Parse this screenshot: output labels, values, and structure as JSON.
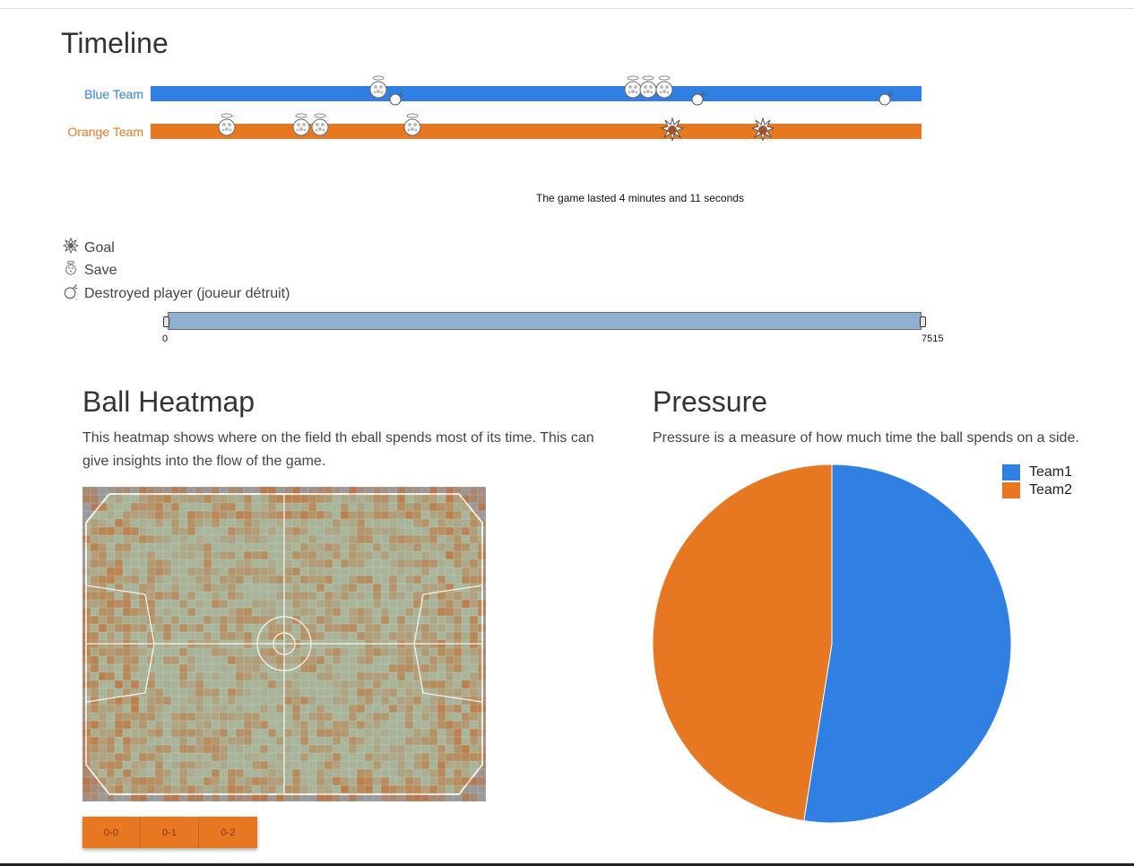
{
  "timeline": {
    "title": "Timeline",
    "teams": [
      {
        "name": "Blue Team",
        "color": "#2f80e2"
      },
      {
        "name": "Orange Team",
        "color": "#e87722"
      }
    ],
    "events": {
      "blue": [
        {
          "type": "save",
          "frame": 2210
        },
        {
          "type": "destroyed",
          "frame": 2400
        },
        {
          "type": "save",
          "frame": 4690
        },
        {
          "type": "save",
          "frame": 4840
        },
        {
          "type": "save",
          "frame": 5000
        },
        {
          "type": "destroyed",
          "frame": 5350
        },
        {
          "type": "destroyed",
          "frame": 7170
        }
      ],
      "orange": [
        {
          "type": "save",
          "frame": 730
        },
        {
          "type": "save",
          "frame": 1460
        },
        {
          "type": "save",
          "frame": 1640
        },
        {
          "type": "save",
          "frame": 2540
        },
        {
          "type": "goal",
          "frame": 5060
        },
        {
          "type": "goal",
          "frame": 5940
        }
      ]
    },
    "duration_text": "The game lasted 4 minutes and 11 seconds",
    "legend": [
      {
        "icon": "goal-icon",
        "label": "Goal"
      },
      {
        "icon": "save-icon",
        "label": "Save"
      },
      {
        "icon": "destroyed-player-icon",
        "label": "Destroyed player (joueur détruit)"
      }
    ],
    "slider": {
      "min": "0",
      "max": "7515"
    }
  },
  "heatmap": {
    "title": "Ball Heatmap",
    "description": "This heatmap shows where on the field th eball spends most of its time. This can give insights into the flow of the game.",
    "buttons": [
      "0-0",
      "0-1",
      "0-2"
    ],
    "heat_color": "#c4692a"
  },
  "pressure": {
    "title": "Pressure",
    "description": "Pressure is a measure of how much time the ball spends on a side.",
    "chart_data": {
      "type": "pie",
      "series": [
        {
          "name": "Team1",
          "value": 52.5,
          "color": "#2f80e2"
        },
        {
          "name": "Team2",
          "value": 47.5,
          "color": "#e87722"
        }
      ],
      "legend": "top-right"
    }
  }
}
